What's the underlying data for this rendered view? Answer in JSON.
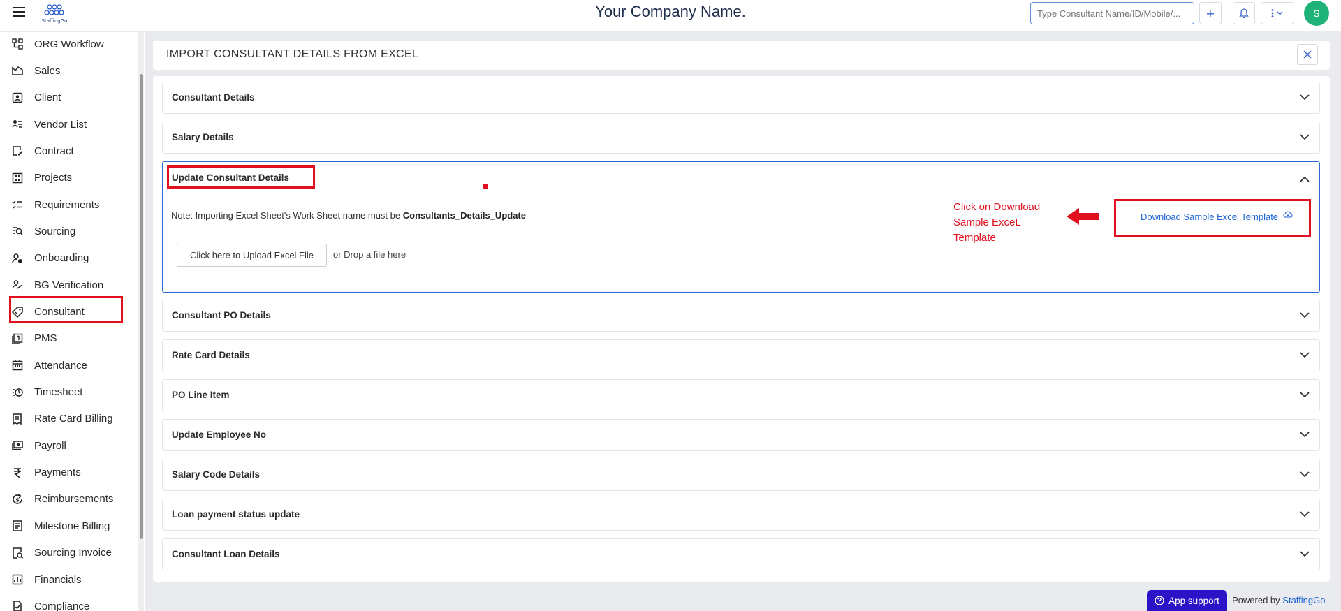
{
  "header": {
    "company_name": "Your Company Name.",
    "search_placeholder": "Type Consultant Name/ID/Mobile/...",
    "logo_text": "StaffingGo",
    "avatar_initial": "S",
    "add_label": "+",
    "bell_icon": "bell-icon",
    "menu_icon": "kebab-menu-icon"
  },
  "sidebar": {
    "items": [
      {
        "label": "ORG Workflow",
        "icon": "org-workflow-icon"
      },
      {
        "label": "Sales",
        "icon": "sales-icon"
      },
      {
        "label": "Client",
        "icon": "client-icon"
      },
      {
        "label": "Vendor List",
        "icon": "vendor-list-icon"
      },
      {
        "label": "Contract",
        "icon": "contract-icon"
      },
      {
        "label": "Projects",
        "icon": "projects-icon"
      },
      {
        "label": "Requirements",
        "icon": "requirements-icon"
      },
      {
        "label": "Sourcing",
        "icon": "sourcing-icon"
      },
      {
        "label": "Onboarding",
        "icon": "onboarding-icon"
      },
      {
        "label": "BG Verification",
        "icon": "bg-verification-icon"
      },
      {
        "label": "Consultant",
        "icon": "consultant-icon"
      },
      {
        "label": "PMS",
        "icon": "pms-icon"
      },
      {
        "label": "Attendance",
        "icon": "attendance-icon"
      },
      {
        "label": "Timesheet",
        "icon": "timesheet-icon"
      },
      {
        "label": "Rate Card Billing",
        "icon": "rate-card-billing-icon"
      },
      {
        "label": "Payroll",
        "icon": "payroll-icon"
      },
      {
        "label": "Payments",
        "icon": "rupee-icon"
      },
      {
        "label": "Reimbursements",
        "icon": "reimbursements-icon"
      },
      {
        "label": "Milestone Billing",
        "icon": "milestone-billing-icon"
      },
      {
        "label": "Sourcing Invoice",
        "icon": "sourcing-invoice-icon"
      },
      {
        "label": "Financials",
        "icon": "financials-icon"
      },
      {
        "label": "Compliance",
        "icon": "compliance-icon"
      }
    ]
  },
  "main": {
    "title": "IMPORT CONSULTANT DETAILS FROM EXCEL",
    "sections": [
      {
        "title": "Consultant Details"
      },
      {
        "title": "Salary Details"
      },
      {
        "title": "Update Consultant Details"
      },
      {
        "title": "Consultant PO Details"
      },
      {
        "title": "Rate Card Details"
      },
      {
        "title": "PO Line Item"
      },
      {
        "title": "Update Employee No"
      },
      {
        "title": "Salary Code Details"
      },
      {
        "title": "Loan payment status update"
      },
      {
        "title": "Consultant Loan Details"
      }
    ],
    "open_section": {
      "note_prefix": "Note: Importing Excel Sheet's Work Sheet name must be ",
      "note_sheet_name": "Consultants_Details_Update",
      "upload_button": "Click here to Upload Excel File",
      "drop_text": "or Drop a file here",
      "download_link": "Download Sample Excel Template"
    }
  },
  "annotation": {
    "line1": "Click on Download",
    "line2": "Sample ExceL",
    "line3": "Template",
    "highlight_color": "#e0101f"
  },
  "footer": {
    "support_label": "App support",
    "powered_by": "Powered by",
    "brand": "StaffingGo"
  }
}
